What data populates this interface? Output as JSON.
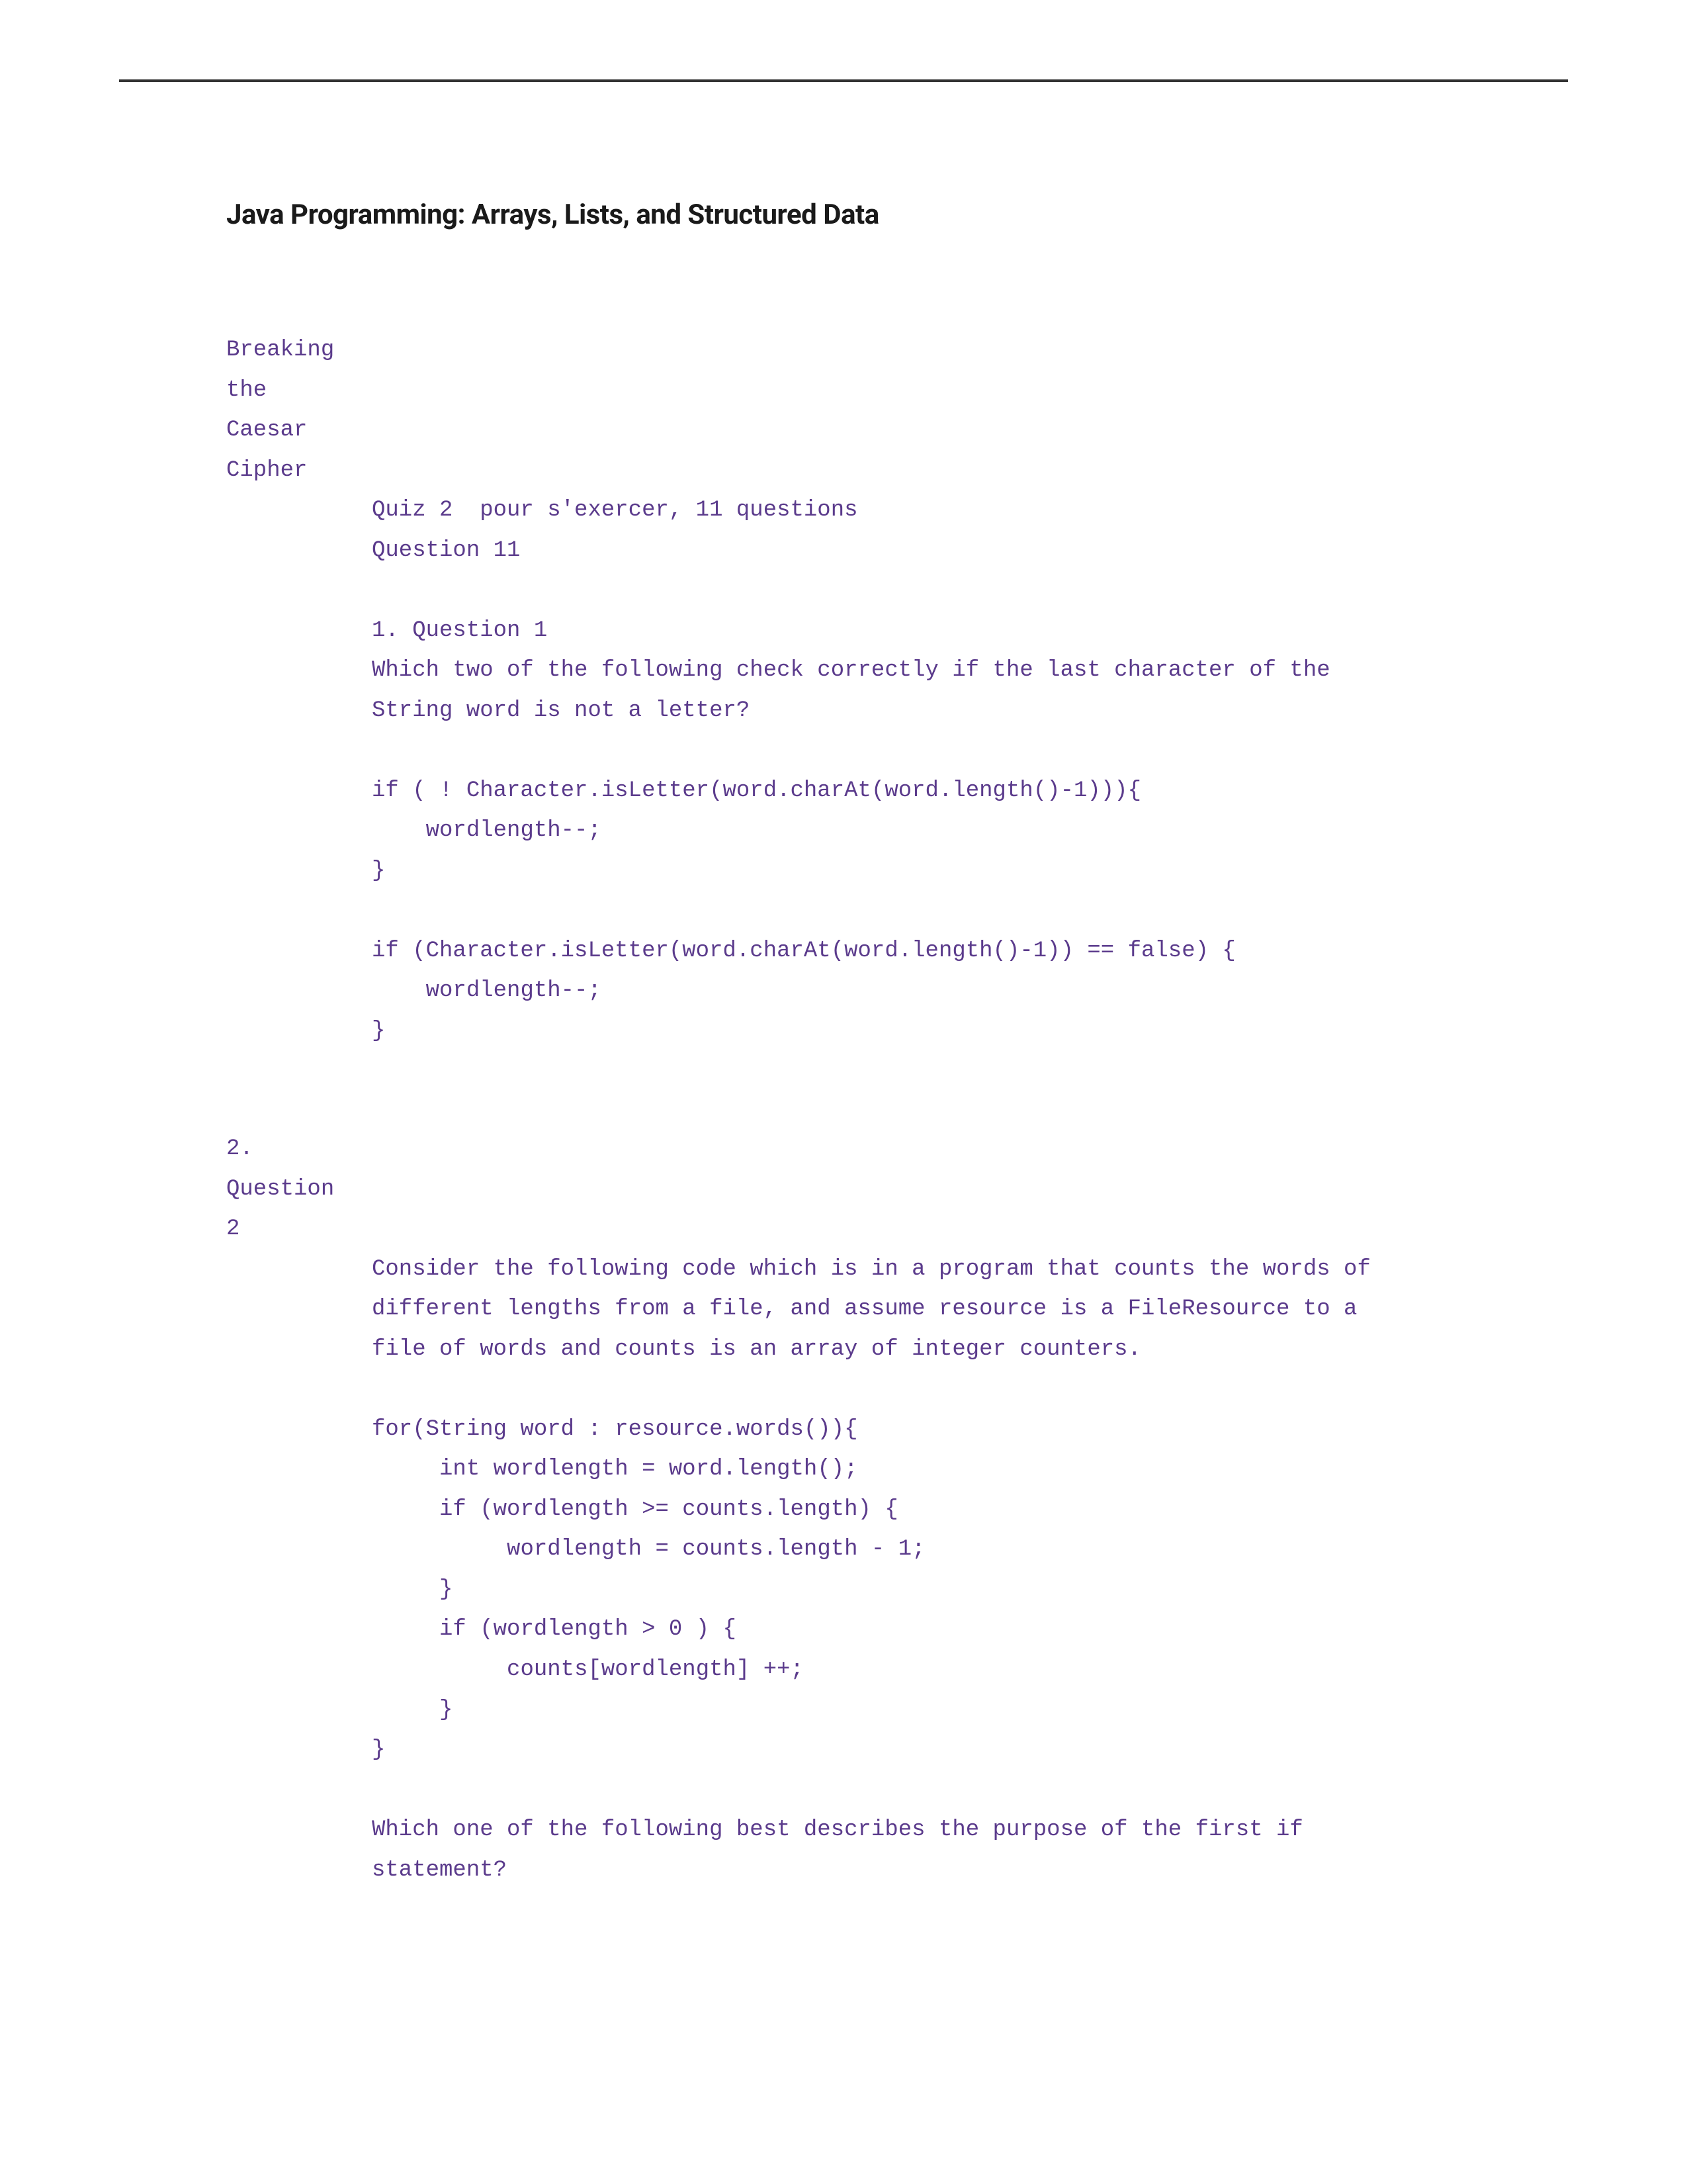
{
  "title": "Java Programming: Arrays, Lists, and Structured Data",
  "section1": {
    "label": "Breaking\nthe\nCaesar\nCipher",
    "body_prefix": "\n\n\n\nQuiz 2  pour s'exercer, 11 questions\nQuestion 11\n\n1. Question 1\nWhich two of the following check correctly if the last character of the\nString word is not a letter?\n\nif ( ! Character.isLetter(word.charAt(word.length()-1))){\n    wordlength--;\n}\n\nif (Character.isLetter(word.charAt(word.length()-1)) == false) {\n    wordlength--;\n}"
  },
  "section2": {
    "label": "2.\nQuestion\n2",
    "body": "\n\n\nConsider the following code which is in a program that counts the words of\ndifferent lengths from a file, and assume resource is a FileResource to a\nfile of words and counts is an array of integer counters.\n\nfor(String word : resource.words()){\n     int wordlength = word.length();\n     if (wordlength >= counts.length) {\n          wordlength = counts.length - 1;\n     }\n     if (wordlength > 0 ) {\n          counts[wordlength] ++;\n     }\n}\n\nWhich one of the following best describes the purpose of the first if\nstatement?"
  }
}
